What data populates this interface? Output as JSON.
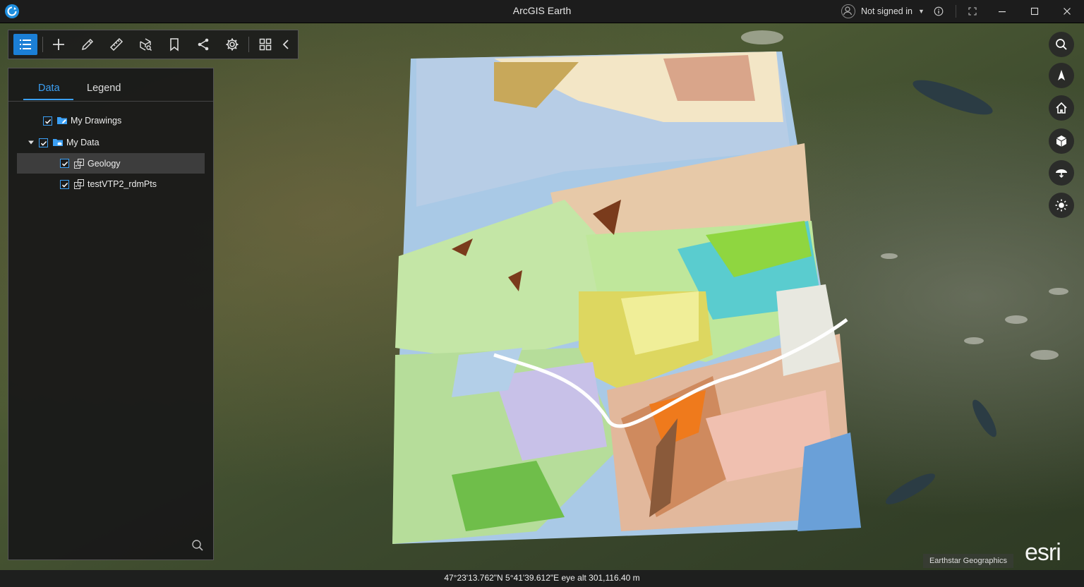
{
  "app": {
    "title": "ArcGIS Earth"
  },
  "user": {
    "status": "Not signed in"
  },
  "toolbar": {
    "tools": [
      "layers-list",
      "add-data",
      "draw",
      "measure",
      "analysis",
      "bookmarks",
      "share",
      "settings",
      "apps",
      "collapse"
    ]
  },
  "panel": {
    "tabs": [
      {
        "label": "Data"
      },
      {
        "label": "Legend"
      }
    ],
    "tree": [
      {
        "label": "My Drawings",
        "checked": true
      },
      {
        "label": "My Data",
        "checked": true,
        "expanded": true
      },
      {
        "label": "Geology",
        "checked": true,
        "selected": true
      },
      {
        "label": "testVTP2_rdmPts",
        "checked": true
      }
    ]
  },
  "status": {
    "coordinates": "47°23'13.762\"N 5°41'39.612\"E  eye alt 301,116.40 m"
  },
  "map": {
    "attribution": "Earthstar Geographics",
    "logo": "esri"
  },
  "colors": {
    "accent": "#1b7fd6",
    "tab_active": "#3ba0f5",
    "panel_bg": "#181818",
    "titlebar_bg": "#1c1c1c"
  }
}
